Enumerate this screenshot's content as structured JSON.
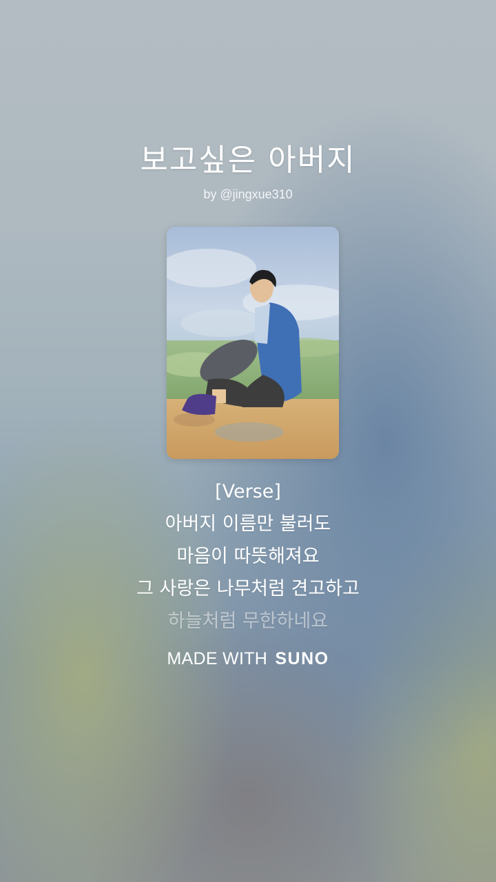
{
  "song": {
    "title": "보고싶은 아버지",
    "byline": "by @jingxue310"
  },
  "cover": {
    "icon": "cover-art-painting-seated-man"
  },
  "lyrics": {
    "lines": [
      "[Verse]",
      "아버지 이름만 불러도",
      "마음이 따뜻해져요",
      "그 사랑은 나무처럼 견고하고",
      "하늘처럼 무한하네요"
    ],
    "active_through": 4
  },
  "footer": {
    "prefix": "MADE WITH",
    "brand": "SUNO"
  },
  "colors": {
    "text": "#ffffff",
    "dim_text": "rgba(255,255,255,0.5)"
  }
}
